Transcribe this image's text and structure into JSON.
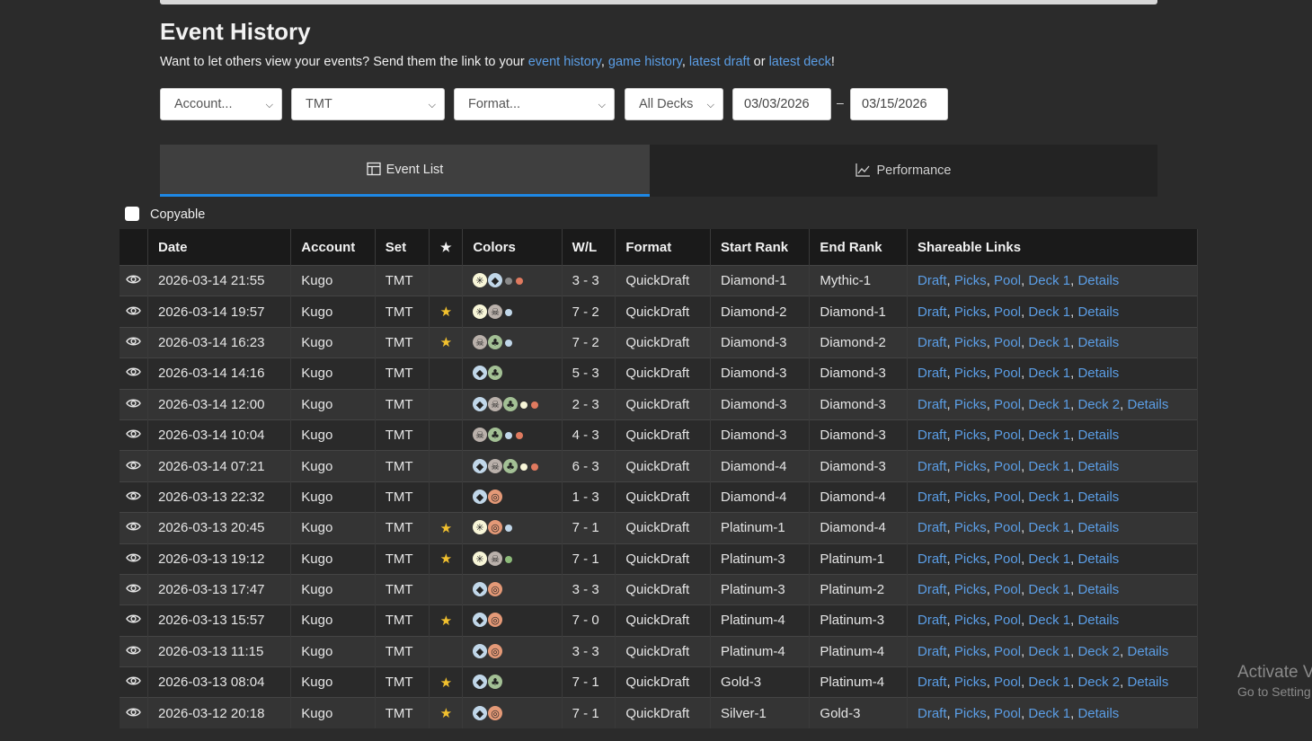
{
  "page": {
    "title": "Event History",
    "subtitle_prefix": "Want to let others view your events? Send them the link to your ",
    "links": [
      "event history",
      "game history",
      "latest draft",
      "latest deck"
    ],
    "subtitle_mid1": ", ",
    "subtitle_mid2": ", ",
    "subtitle_or": " or ",
    "subtitle_end": "!"
  },
  "filters": {
    "account": "Account...",
    "set": "TMT",
    "format": "Format...",
    "decks": "All Decks",
    "date_from": "03/03/2026",
    "date_sep": "–",
    "date_to": "03/15/2026"
  },
  "tabs": {
    "event_list": "Event List",
    "performance": "Performance"
  },
  "copyable_label": "Copyable",
  "table": {
    "headers": [
      "Date",
      "Account",
      "Set",
      "Colors",
      "W/L",
      "Format",
      "Start Rank",
      "End Rank",
      "Shareable Links"
    ],
    "rows": [
      {
        "date": "2026-03-14 21:55",
        "account": "Kugo",
        "set": "TMT",
        "star": false,
        "colors": [
          "W",
          "U"
        ],
        "dots": [
          "B",
          "R"
        ],
        "wl": "3 - 3",
        "format": "QuickDraft",
        "start": "Diamond-1",
        "end": "Mythic-1",
        "links": [
          "Draft",
          "Picks",
          "Pool",
          "Deck 1",
          "Details"
        ]
      },
      {
        "date": "2026-03-14 19:57",
        "account": "Kugo",
        "set": "TMT",
        "star": true,
        "colors": [
          "W",
          "B"
        ],
        "dots": [
          "U"
        ],
        "wl": "7 - 2",
        "format": "QuickDraft",
        "start": "Diamond-2",
        "end": "Diamond-1",
        "links": [
          "Draft",
          "Picks",
          "Pool",
          "Deck 1",
          "Details"
        ]
      },
      {
        "date": "2026-03-14 16:23",
        "account": "Kugo",
        "set": "TMT",
        "star": true,
        "colors": [
          "B",
          "G"
        ],
        "dots": [
          "U"
        ],
        "wl": "7 - 2",
        "format": "QuickDraft",
        "start": "Diamond-3",
        "end": "Diamond-2",
        "links": [
          "Draft",
          "Picks",
          "Pool",
          "Deck 1",
          "Details"
        ]
      },
      {
        "date": "2026-03-14 14:16",
        "account": "Kugo",
        "set": "TMT",
        "star": false,
        "colors": [
          "U",
          "G"
        ],
        "dots": [],
        "wl": "5 - 3",
        "format": "QuickDraft",
        "start": "Diamond-3",
        "end": "Diamond-3",
        "links": [
          "Draft",
          "Picks",
          "Pool",
          "Deck 1",
          "Details"
        ]
      },
      {
        "date": "2026-03-14 12:00",
        "account": "Kugo",
        "set": "TMT",
        "star": false,
        "colors": [
          "U",
          "B",
          "G"
        ],
        "dots": [
          "W",
          "R"
        ],
        "wl": "2 - 3",
        "format": "QuickDraft",
        "start": "Diamond-3",
        "end": "Diamond-3",
        "links": [
          "Draft",
          "Picks",
          "Pool",
          "Deck 1",
          "Deck 2",
          "Details"
        ]
      },
      {
        "date": "2026-03-14 10:04",
        "account": "Kugo",
        "set": "TMT",
        "star": false,
        "colors": [
          "B",
          "G"
        ],
        "dots": [
          "U",
          "R"
        ],
        "wl": "4 - 3",
        "format": "QuickDraft",
        "start": "Diamond-3",
        "end": "Diamond-3",
        "links": [
          "Draft",
          "Picks",
          "Pool",
          "Deck 1",
          "Details"
        ]
      },
      {
        "date": "2026-03-14 07:21",
        "account": "Kugo",
        "set": "TMT",
        "star": false,
        "colors": [
          "U",
          "B",
          "G"
        ],
        "dots": [
          "W",
          "R"
        ],
        "wl": "6 - 3",
        "format": "QuickDraft",
        "start": "Diamond-4",
        "end": "Diamond-3",
        "links": [
          "Draft",
          "Picks",
          "Pool",
          "Deck 1",
          "Details"
        ]
      },
      {
        "date": "2026-03-13 22:32",
        "account": "Kugo",
        "set": "TMT",
        "star": false,
        "colors": [
          "U",
          "R"
        ],
        "dots": [],
        "wl": "1 - 3",
        "format": "QuickDraft",
        "start": "Diamond-4",
        "end": "Diamond-4",
        "links": [
          "Draft",
          "Picks",
          "Pool",
          "Deck 1",
          "Details"
        ]
      },
      {
        "date": "2026-03-13 20:45",
        "account": "Kugo",
        "set": "TMT",
        "star": true,
        "colors": [
          "W",
          "R"
        ],
        "dots": [
          "U"
        ],
        "wl": "7 - 1",
        "format": "QuickDraft",
        "start": "Platinum-1",
        "end": "Diamond-4",
        "links": [
          "Draft",
          "Picks",
          "Pool",
          "Deck 1",
          "Details"
        ]
      },
      {
        "date": "2026-03-13 19:12",
        "account": "Kugo",
        "set": "TMT",
        "star": true,
        "colors": [
          "W",
          "B"
        ],
        "dots": [
          "G"
        ],
        "wl": "7 - 1",
        "format": "QuickDraft",
        "start": "Platinum-3",
        "end": "Platinum-1",
        "links": [
          "Draft",
          "Picks",
          "Pool",
          "Deck 1",
          "Details"
        ]
      },
      {
        "date": "2026-03-13 17:47",
        "account": "Kugo",
        "set": "TMT",
        "star": false,
        "colors": [
          "U",
          "R"
        ],
        "dots": [],
        "wl": "3 - 3",
        "format": "QuickDraft",
        "start": "Platinum-3",
        "end": "Platinum-2",
        "links": [
          "Draft",
          "Picks",
          "Pool",
          "Deck 1",
          "Details"
        ]
      },
      {
        "date": "2026-03-13 15:57",
        "account": "Kugo",
        "set": "TMT",
        "star": true,
        "colors": [
          "U",
          "R"
        ],
        "dots": [],
        "wl": "7 - 0",
        "format": "QuickDraft",
        "start": "Platinum-4",
        "end": "Platinum-3",
        "links": [
          "Draft",
          "Picks",
          "Pool",
          "Deck 1",
          "Details"
        ]
      },
      {
        "date": "2026-03-13 11:15",
        "account": "Kugo",
        "set": "TMT",
        "star": false,
        "colors": [
          "U",
          "R"
        ],
        "dots": [],
        "wl": "3 - 3",
        "format": "QuickDraft",
        "start": "Platinum-4",
        "end": "Platinum-4",
        "links": [
          "Draft",
          "Picks",
          "Pool",
          "Deck 1",
          "Deck 2",
          "Details"
        ]
      },
      {
        "date": "2026-03-13 08:04",
        "account": "Kugo",
        "set": "TMT",
        "star": true,
        "colors": [
          "U",
          "G"
        ],
        "dots": [],
        "wl": "7 - 1",
        "format": "QuickDraft",
        "start": "Gold-3",
        "end": "Platinum-4",
        "links": [
          "Draft",
          "Picks",
          "Pool",
          "Deck 1",
          "Deck 2",
          "Details"
        ]
      },
      {
        "date": "2026-03-12 20:18",
        "account": "Kugo",
        "set": "TMT",
        "star": true,
        "colors": [
          "U",
          "R"
        ],
        "dots": [],
        "wl": "7 - 1",
        "format": "QuickDraft",
        "start": "Silver-1",
        "end": "Gold-3",
        "links": [
          "Draft",
          "Picks",
          "Pool",
          "Deck 1",
          "Details"
        ]
      }
    ]
  },
  "mana_colors": {
    "W": "#f8f6d8",
    "U": "#c1d7e9",
    "B": "#bab1ab",
    "R": "#e49977",
    "G": "#a3c095"
  },
  "dot_colors": {
    "W": "#f8f6d8",
    "U": "#c1d7e9",
    "B": "#8a8a8a",
    "R": "#e07a5f",
    "G": "#8dbb7a"
  },
  "watermark": {
    "line1": "Activate V",
    "line2": "Go to Setting"
  }
}
